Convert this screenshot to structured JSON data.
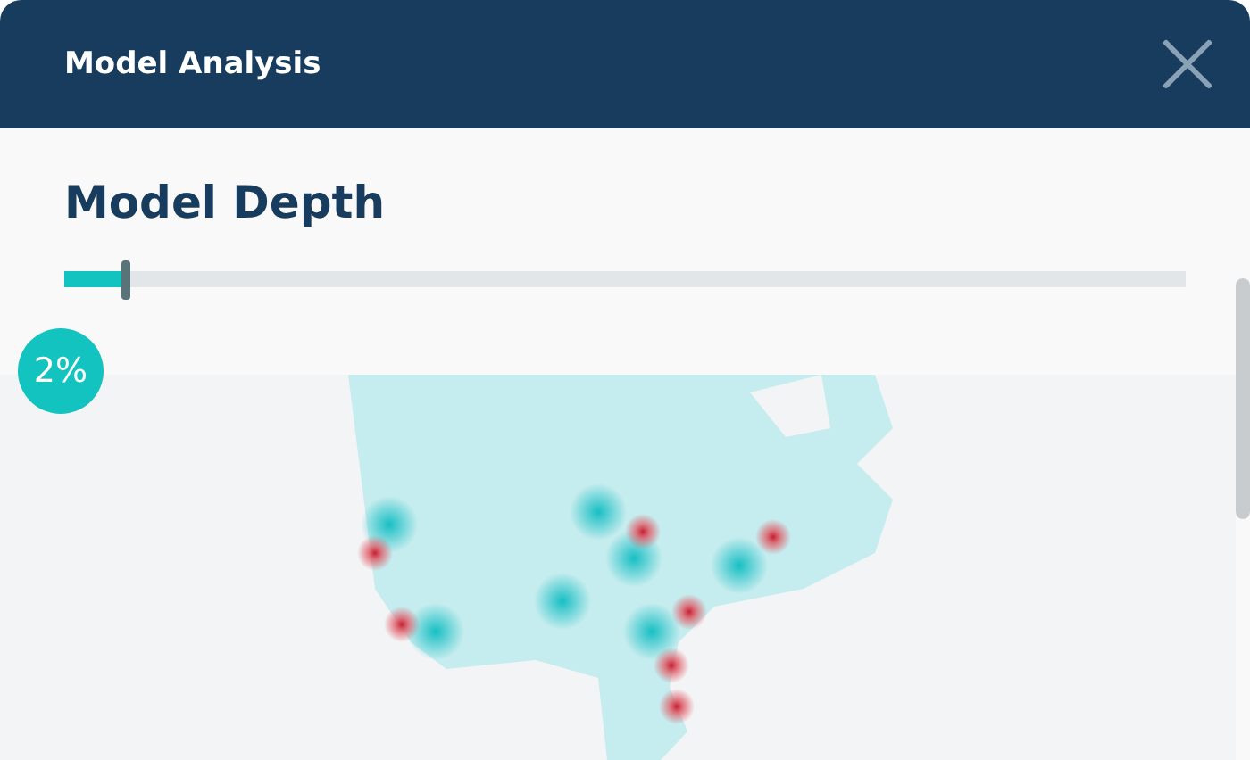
{
  "window": {
    "title": "Model Analysis"
  },
  "section": {
    "title": "Model Depth"
  },
  "slider": {
    "level": 0.054,
    "reading": "2%"
  }
}
